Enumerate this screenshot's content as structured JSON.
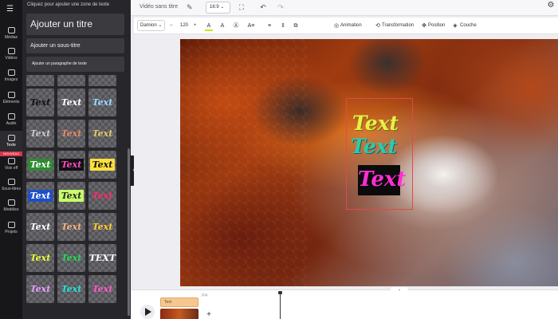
{
  "panel": {
    "hint": "Cliquez pour ajouter une zone de texte",
    "add_title": "Ajouter un titre",
    "add_subtitle": "Ajouter un sous-titre",
    "add_paragraph": "Ajouter un paragraphe de texte"
  },
  "rail": {
    "items": [
      {
        "label": "Médias",
        "icon": "media-icon"
      },
      {
        "label": "Vidéos",
        "icon": "video-icon"
      },
      {
        "label": "Images",
        "icon": "image-icon"
      },
      {
        "label": "Éléments",
        "icon": "elements-icon"
      },
      {
        "label": "Audio",
        "icon": "audio-icon"
      },
      {
        "label": "Texte",
        "icon": "text-icon"
      },
      {
        "label": "Voix off",
        "icon": "voiceover-icon"
      },
      {
        "label": "Sous-titres",
        "icon": "subtitles-icon"
      },
      {
        "label": "Modèles",
        "icon": "templates-icon"
      },
      {
        "label": "Projets",
        "icon": "projects-icon"
      }
    ],
    "badge": "NOUVEAU"
  },
  "styles": [
    {
      "text": "Text",
      "color": "#111111",
      "bg": ""
    },
    {
      "text": "Text",
      "color": "#ffffff",
      "bg": ""
    },
    {
      "text": "Text",
      "color": "#9ad8ff",
      "bg": ""
    },
    {
      "text": "Text",
      "color": "#c9c9c9",
      "bg": ""
    },
    {
      "text": "Text",
      "color": "#e58a6a",
      "bg": ""
    },
    {
      "text": "Text",
      "color": "#e3c766",
      "bg": ""
    },
    {
      "text": "Text",
      "color": "#ffffff",
      "bg": "#2f8a2f"
    },
    {
      "text": "Text",
      "color": "#ff4ac8",
      "bg": "#111111"
    },
    {
      "text": "Text",
      "color": "#111111",
      "bg": "#ffe03b"
    },
    {
      "text": "Text",
      "color": "#ffffff",
      "bg": "#1e4fc6"
    },
    {
      "text": "Text",
      "color": "#2a2a2a",
      "bg": "#c8ff6a"
    },
    {
      "text": "Text",
      "color": "#ff2b6d",
      "bg": ""
    },
    {
      "text": "Text",
      "color": "#ffffff",
      "bg": ""
    },
    {
      "text": "Text",
      "color": "#f5b27a",
      "bg": ""
    },
    {
      "text": "Text",
      "color": "#ffcc2b",
      "bg": ""
    },
    {
      "text": "Text",
      "color": "#e8ff3a",
      "bg": ""
    },
    {
      "text": "Text",
      "color": "#27d856",
      "bg": ""
    },
    {
      "text": "TEXT",
      "color": "#ffffff",
      "bg": ""
    },
    {
      "text": "Text",
      "color": "#e6a0ff",
      "bg": ""
    },
    {
      "text": "Text",
      "color": "#2ae0d0",
      "bg": ""
    },
    {
      "text": "Text",
      "color": "#ff59c9",
      "bg": ""
    }
  ],
  "topbar": {
    "doc_title": "Vidéo sans titre",
    "ratio": "16:9",
    "undo": "↶",
    "redo": "↷",
    "settings": "⚙"
  },
  "format": {
    "font": "Damion",
    "minus": "−",
    "size": "120",
    "plus": "+",
    "animation": "Animation",
    "transformation": "Transformation",
    "position": "Position",
    "couche": "Couche"
  },
  "canvas": {
    "text1": "Text",
    "text2": "Text",
    "text3": "Text"
  },
  "timeline": {
    "clip_label": "Text",
    "track_label": "Pl4",
    "add": "+",
    "toggle": "⌄"
  }
}
